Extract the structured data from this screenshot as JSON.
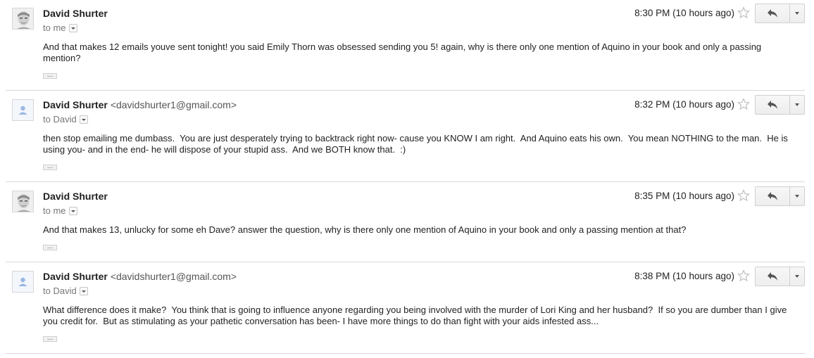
{
  "messages": [
    {
      "sender": "David Shurter",
      "email": "",
      "recipient": "to me",
      "time": "8:30 PM (10 hours ago)",
      "body": "And that makes 12 emails youve sent tonight! you said Emily Thorn was obsessed sending you 5! again, why is there only one mention of Aquino in your book and only a passing mention?",
      "avatar": "photo-avatar",
      "quoted_text": "..."
    },
    {
      "sender": "David Shurter",
      "email": "<davidshurter1@gmail.com>",
      "recipient": "to David",
      "time": "8:32 PM (10 hours ago)",
      "body": "then stop emailing me dumbass.  You are just desperately trying to backtrack right now- cause you KNOW I am right.  And Aquino eats his own.  You mean NOTHING to the man.  He is using you- and in the end- he will dispose of your stupid ass.  And we BOTH know that.  :)",
      "avatar": "default-person-avatar",
      "quoted_text": "..."
    },
    {
      "sender": "David Shurter",
      "email": "",
      "recipient": "to me",
      "time": "8:35 PM (10 hours ago)",
      "body": "And that makes 13, unlucky for some eh Dave? answer the question, why is there only one mention of Aquino in your book and only a passing mention at that?",
      "avatar": "photo-avatar",
      "quoted_text": "..."
    },
    {
      "sender": "David Shurter",
      "email": "<davidshurter1@gmail.com>",
      "recipient": "to David",
      "time": "8:38 PM (10 hours ago)",
      "body": "What difference does it make?  You think that is going to influence anyone regarding you being involved with the murder of Lori King and her husband?  If so you are dumber than I give you credit for.  But as stimulating as your pathetic conversation has been- I have more things to do than fight with your aids infested ass...",
      "avatar": "default-person-avatar",
      "quoted_text": "..."
    }
  ],
  "icons": {
    "star": "star-outline-icon",
    "reply": "reply-arrow-icon",
    "more": "dropdown-arrow-icon",
    "recipient_details": "chevron-down-icon"
  },
  "colors": {
    "default_avatar_bg": "#e7eef8",
    "default_avatar_fg": "#9bb7e2",
    "divider": "#d8d8d8"
  }
}
